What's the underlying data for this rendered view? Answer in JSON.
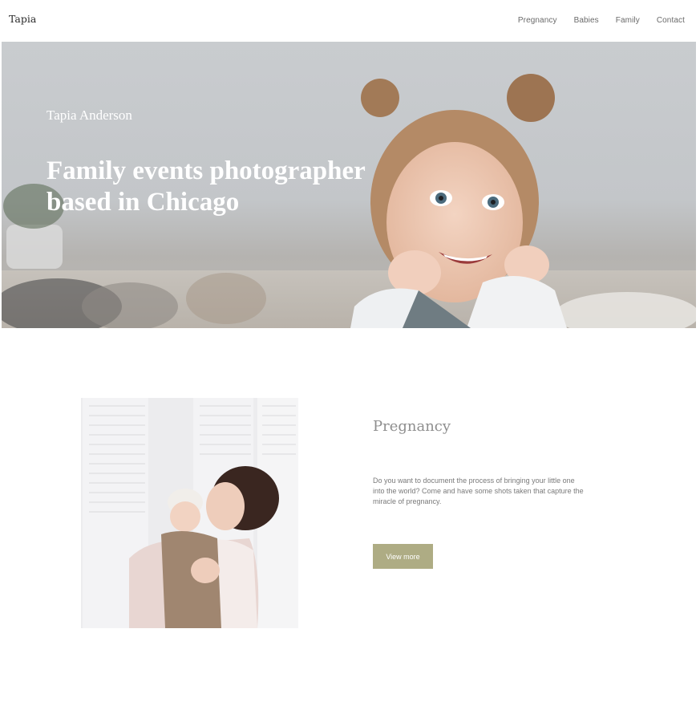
{
  "header": {
    "logo": "Tapia",
    "nav": [
      "Pregnancy",
      "Babies",
      "Family",
      "Contact"
    ]
  },
  "hero": {
    "subtitle": "Tapia Anderson",
    "title": "Family events photographer based in Chicago",
    "image": "smiling-girl-photo"
  },
  "section": {
    "image": "mother-kissing-baby-photo",
    "title": "Pregnancy",
    "description": "Do you want to document the process of bringing your little one into the world? Come and have some shots taken that capture the miracle of pregnancy.",
    "button_label": "View more"
  },
  "colors": {
    "accent": "#aeac84",
    "background": "#ffffff"
  }
}
